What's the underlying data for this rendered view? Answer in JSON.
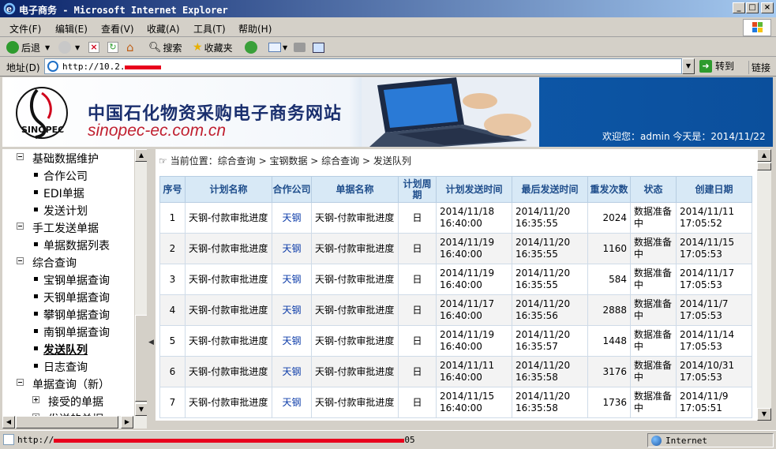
{
  "window": {
    "title": "电子商务 - Microsoft Internet Explorer",
    "minimize": "_",
    "maximize": "□",
    "close": "×"
  },
  "menu": [
    "文件(F)",
    "编辑(E)",
    "查看(V)",
    "收藏(A)",
    "工具(T)",
    "帮助(H)"
  ],
  "toolbar": {
    "back": "后退",
    "search": "搜索",
    "favorites": "收藏夹"
  },
  "address": {
    "label": "地址(D)",
    "url_visible": "http://10.2.",
    "go": "转到",
    "links": "链接"
  },
  "banner": {
    "title_cn": "中国石化物资采购电子商务网站",
    "title_en": "sinopec-ec.com.cn",
    "logo_text": "SINOPEC",
    "welcome": "欢迎您：admin     今天是：2014/11/22"
  },
  "sidebar": {
    "groups": [
      {
        "label": "基础数据维护",
        "expanded": true,
        "items": [
          "合作公司",
          "EDI单据",
          "发送计划"
        ]
      },
      {
        "label": "手工发送单据",
        "expanded": true,
        "items": [
          "单据数据列表"
        ]
      },
      {
        "label": "综合查询",
        "expanded": true,
        "items": [
          "宝钢单据查询",
          "天钢单据查询",
          "攀钢单据查询",
          "南钢单据查询",
          "发送队列",
          "日志查询"
        ]
      },
      {
        "label": "单据查询（新）",
        "expanded": true,
        "subgroups": [
          {
            "label": "接受的单据",
            "expanded": false
          },
          {
            "label": "发送的单据",
            "expanded": false
          }
        ]
      }
    ],
    "active_item": "发送队列"
  },
  "breadcrumb": "当前位置：综合查询 > 宝钢数据 > 综合查询 > 发送队列",
  "table": {
    "headers": [
      "序号",
      "计划名称",
      "合作公司",
      "单据名称",
      "计划周期",
      "计划发送时间",
      "最后发送时间",
      "重发次数",
      "状态",
      "创建日期"
    ],
    "rows": [
      [
        "1",
        "天钢-付款审批进度",
        "天钢",
        "天钢-付款审批进度",
        "日",
        "2014/11/18 16:40:00",
        "2014/11/20 16:35:55",
        "2024",
        "数据准备中",
        "2014/11/11 17:05:52"
      ],
      [
        "2",
        "天钢-付款审批进度",
        "天钢",
        "天钢-付款审批进度",
        "日",
        "2014/11/19 16:40:00",
        "2014/11/20 16:35:55",
        "1160",
        "数据准备中",
        "2014/11/15 17:05:53"
      ],
      [
        "3",
        "天钢-付款审批进度",
        "天钢",
        "天钢-付款审批进度",
        "日",
        "2014/11/19 16:40:00",
        "2014/11/20 16:35:55",
        "584",
        "数据准备中",
        "2014/11/17 17:05:53"
      ],
      [
        "4",
        "天钢-付款审批进度",
        "天钢",
        "天钢-付款审批进度",
        "日",
        "2014/11/17 16:40:00",
        "2014/11/20 16:35:56",
        "2888",
        "数据准备中",
        "2014/11/7 17:05:53"
      ],
      [
        "5",
        "天钢-付款审批进度",
        "天钢",
        "天钢-付款审批进度",
        "日",
        "2014/11/19 16:40:00",
        "2014/11/20 16:35:57",
        "1448",
        "数据准备中",
        "2014/11/14 17:05:53"
      ],
      [
        "6",
        "天钢-付款审批进度",
        "天钢",
        "天钢-付款审批进度",
        "日",
        "2014/11/11 16:40:00",
        "2014/11/20 16:35:58",
        "3176",
        "数据准备中",
        "2014/10/31 17:05:53"
      ],
      [
        "7",
        "天钢-付款审批进度",
        "天钢",
        "天钢-付款审批进度",
        "日",
        "2014/11/15 16:40:00",
        "2014/11/20 16:35:58",
        "1736",
        "数据准备中",
        "2014/11/9 17:05:51"
      ]
    ]
  },
  "status": {
    "text_visible": "http://",
    "text_tail": "05",
    "zone": "Internet"
  },
  "colors": {
    "header_bg": "#d8e9f6",
    "header_text": "#1f4e8c",
    "link": "#0a3aa8",
    "banner_blue": "#0d56a6",
    "redaction": "#e8001c"
  }
}
